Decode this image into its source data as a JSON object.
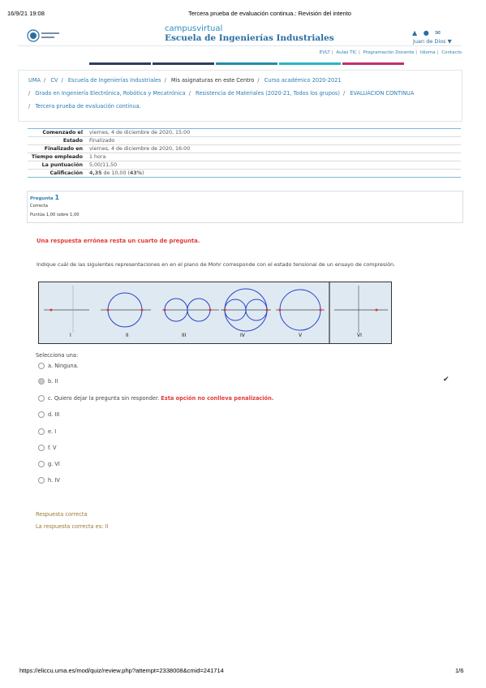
{
  "print_header": {
    "datetime": "16/9/21 19:08",
    "title": "Tercera prueba de evaluación continua.: Revisión del intento"
  },
  "print_footer": {
    "url": "https://eliccu.uma.es/mod/quiz/review.php?attempt=2338008&cmid=241714",
    "page": "1/6"
  },
  "site": {
    "logo_text": "UNIVERSIDAD DE MÁLAGA",
    "brand_top": "campusvirtual",
    "brand_main": "Escuela de Ingenierías Industriales"
  },
  "user": {
    "name": "Juan de Dios ▼",
    "icons": [
      "bell-icon",
      "chat-icon",
      "mail-icon"
    ]
  },
  "top_links": [
    "EVLT",
    "Aulas TIC",
    "Programación Docente",
    "Idioma",
    "Contacto"
  ],
  "color_bar": [
    "#2b3e5c",
    "#2b3e5c",
    "#1f8fa6",
    "#2bb3c6",
    "#c0306b"
  ],
  "breadcrumb": [
    {
      "label": "UMA",
      "link": true
    },
    {
      "label": "CV",
      "link": true
    },
    {
      "label": "Escuela de Ingenierías Industriales",
      "link": true
    },
    {
      "label": "Mis asignaturas en este Centro",
      "link": false
    },
    {
      "label": "Curso académico 2020-2021",
      "link": true
    },
    {
      "label": "Grado en Ingeniería Electrónica, Robótica y Mecatrónica",
      "link": true
    },
    {
      "label": "Resistencia de Materiales (2020-21, Todos los grupos)",
      "link": true
    },
    {
      "label": "EVALUACION CONTINUA",
      "link": true
    },
    {
      "label": "Tercera prueba de evaluación continua.",
      "link": true
    }
  ],
  "summary": [
    {
      "label": "Comenzado el",
      "value": "viernes, 4 de diciembre de 2020, 15:00"
    },
    {
      "label": "Estado",
      "value": "Finalizado"
    },
    {
      "label": "Finalizado en",
      "value": "viernes, 4 de diciembre de 2020, 16:00"
    },
    {
      "label": "Tiempo empleado",
      "value": "1 hora"
    },
    {
      "label": "La puntuación",
      "value": "5,00/11,50"
    },
    {
      "label": "Calificación",
      "value_bold": "4,35",
      "value_rest": " de 10,00 (",
      "value_pct": "43%",
      "value_end": ")"
    }
  ],
  "question": {
    "label": "Pregunta",
    "number": "1",
    "state": "Correcta",
    "grade": "Puntúa 1,00 sobre 1,00",
    "warning": "Una respuesta errónea resta un cuarto de pregunta.",
    "text": "Indique cuál de las siguientes representaciones en en el plano de Mohr corresponde con el estado tensional de un ensayo de compresión.",
    "figure_labels": [
      "I",
      "II",
      "III",
      "IV",
      "V",
      "VI"
    ],
    "select_label": "Selecciona una:",
    "options": [
      {
        "text": "a. Ninguna.",
        "selected": false
      },
      {
        "text": "b. II",
        "selected": true
      },
      {
        "text": "c. Quiero dejar la pregunta sin responder.",
        "note": "Esta opción no conlleva penalización.",
        "selected": false
      },
      {
        "text": "d. III",
        "selected": false
      },
      {
        "text": "e. I",
        "selected": false
      },
      {
        "text": "f. V",
        "selected": false
      },
      {
        "text": "g. VI",
        "selected": false
      },
      {
        "text": "h. IV",
        "selected": false
      }
    ],
    "feedback": "Respuesta correcta",
    "right_answer": "La respuesta correcta es: II"
  }
}
